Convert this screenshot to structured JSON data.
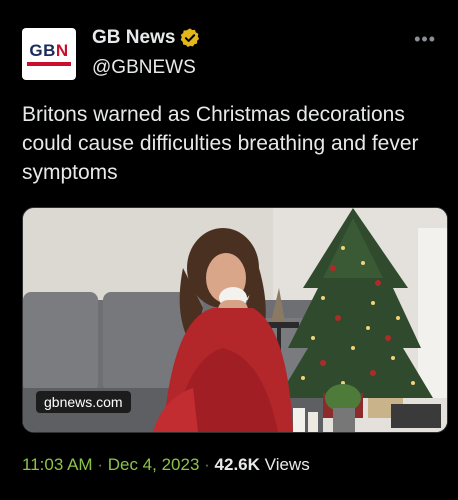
{
  "author": {
    "name": "GB News",
    "handle": "@GBNEWS",
    "avatar_logo": "GBN",
    "verified": true
  },
  "more_menu": "•••",
  "tweet": {
    "text": "Britons warned as Christmas decorations could cause difficulties breathing and fever symptoms"
  },
  "media": {
    "link_label": "gbnews.com",
    "description": "Woman in red blanket sneezing on a sofa next to a Christmas tree"
  },
  "meta": {
    "time": "11:03 AM",
    "separator": "·",
    "date": "Dec 4, 2023",
    "views_count": "42.6K",
    "views_label": "Views"
  },
  "colors": {
    "background": "#000000",
    "text": "#e7e9ea",
    "muted": "#71767b",
    "timestamp": "#8bc34a",
    "verified_badge": "#e2b719"
  },
  "icons": {
    "verified": "verified-badge-icon",
    "more": "more-horizontal-icon"
  }
}
